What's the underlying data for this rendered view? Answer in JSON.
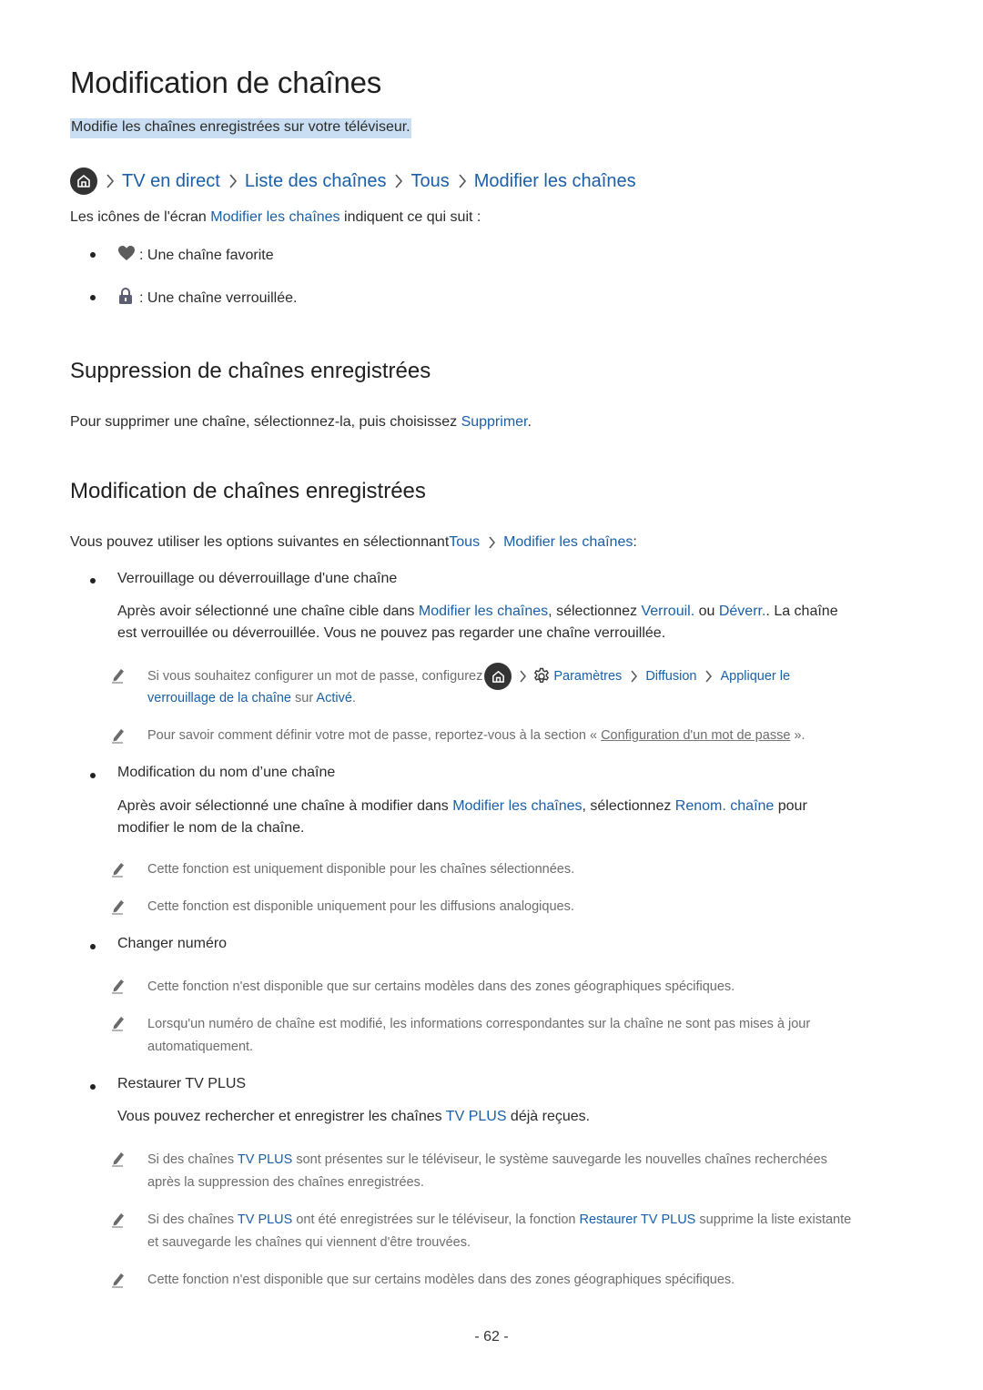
{
  "page": {
    "title": "Modification de chaînes",
    "subtitle": "Modifie les chaînes enregistrées sur votre téléviseur.",
    "breadcrumb": {
      "home_icon": "home-icon",
      "items": [
        "TV en direct",
        "Liste des chaînes",
        "Tous",
        "Modifier les chaînes"
      ]
    },
    "intro": {
      "before": "Les icônes de l'écran ",
      "link": "Modifier les chaînes",
      "after": " indiquent ce qui suit :"
    },
    "icon_legend": [
      {
        "icon": "heart-icon",
        "text": ": Une chaîne favorite"
      },
      {
        "icon": "lock-icon",
        "text": ": Une chaîne verrouillée."
      }
    ],
    "section_delete": {
      "heading": "Suppression de chaînes enregistrées",
      "text_before": "Pour supprimer une chaîne, sélectionnez-la, puis choisissez ",
      "link": "Supprimer",
      "text_after": "."
    },
    "section_edit": {
      "heading": "Modification de chaînes enregistrées",
      "intro_before": "Vous pouvez utiliser les options suivantes en sélectionnant ",
      "intro_link1": "Tous",
      "intro_link2": "Modifier les chaînes",
      "intro_after": " :",
      "lock": {
        "label": "Verrouillage ou déverrouillage d'une chaîne",
        "p1_before": "Après avoir sélectionné une chaîne cible dans ",
        "p1_link1": "Modifier les chaînes",
        "p1_mid1": ", sélectionnez ",
        "p1_link2": "Verrouil.",
        "p1_mid2": " ou ",
        "p1_link3": "Déverr.",
        "p1_after": ". La chaîne",
        "p2": "est verrouillée ou déverrouillée. Vous ne pouvez pas regarder une chaîne verrouillée.",
        "note1": {
          "before": "Si vous souhaitez configurer un mot de passe, configurez ",
          "link_settings": "Paramètres",
          "link_broadcast": "Diffusion",
          "link_apply": "Appliquer le",
          "line2_link": "verrouillage de la chaîne",
          "line2_mid": " sur ",
          "line2_link2": "Activé",
          "line2_after": "."
        },
        "note2": {
          "before": "Pour savoir comment définir votre mot de passe, reportez-vous à la section « ",
          "link": "Configuration d'un mot de passe",
          "after": " »."
        }
      },
      "rename": {
        "label": "Modification du nom d’une chaîne",
        "p1_before": "Après avoir sélectionné une chaîne à modifier dans ",
        "p1_link1": "Modifier les chaînes",
        "p1_mid": ", sélectionnez ",
        "p1_link2": "Renom. chaîne",
        "p1_after": " pour",
        "p2": "modifier le nom de la chaîne.",
        "note1": "Cette fonction est uniquement disponible pour les chaînes sélectionnées.",
        "note2": "Cette fonction est disponible uniquement pour les diffusions analogiques."
      },
      "change_number": {
        "label": "Changer numéro",
        "note1": "Cette fonction n'est disponible que sur certains modèles dans des zones géographiques spécifiques.",
        "note2_line1": "Lorsqu'un numéro de chaîne est modifié, les informations correspondantes sur la chaîne ne sont pas mises à jour",
        "note2_line2": "automatiquement."
      },
      "restore": {
        "label": "Restaurer TV PLUS",
        "p_before": "Vous pouvez rechercher et enregistrer les chaînes ",
        "p_link": "TV PLUS",
        "p_after": " déjà reçues.",
        "note1_before": "Si des chaînes ",
        "note1_link": "TV PLUS",
        "note1_after": " sont présentes sur le téléviseur, le système sauvegarde les nouvelles chaînes recherchées",
        "note1_line2": "après la suppression des chaînes enregistrées.",
        "note2_before": "Si des chaînes ",
        "note2_link1": "TV PLUS",
        "note2_mid": " ont été enregistrées sur le téléviseur, la fonction ",
        "note2_link2": "Restaurer TV PLUS",
        "note2_after": " supprime la liste existante",
        "note2_line2": "et sauvegarde les chaînes qui viennent d'être trouvées.",
        "note3": "Cette fonction n'est disponible que sur certains modèles dans des zones géographiques spécifiques."
      }
    },
    "page_number": "- 62 -",
    "colors": {
      "link": "#1a5fa8",
      "highlight": "#c9def2",
      "note_text": "#6d6d6d",
      "body_text": "#2b2b2b"
    }
  }
}
